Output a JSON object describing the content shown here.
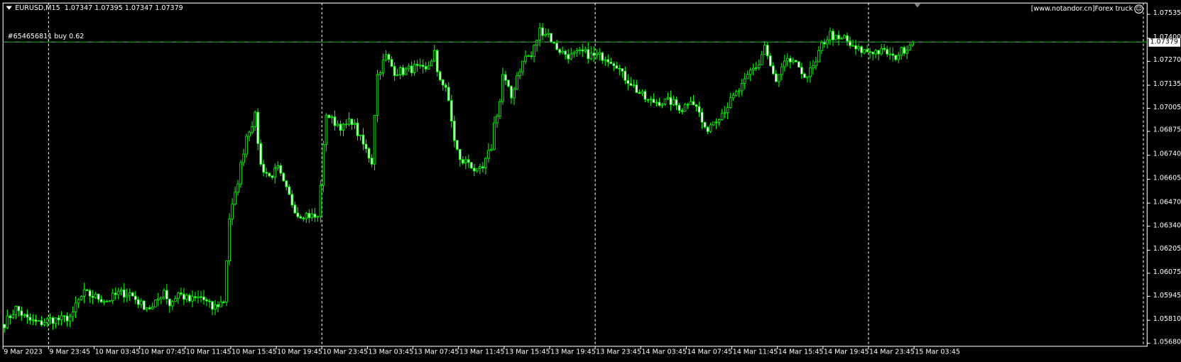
{
  "header": {
    "symbol": "EURUSD,M15",
    "ohlc": "1.07347 1.07395 1.07347 1.07379"
  },
  "order_line": {
    "label": "#654656811 buy 0.62",
    "price": 1.07379
  },
  "current_price_label": "1.07379",
  "brand": {
    "text": "[www.notandor.cn]Forex truck",
    "icon": "smiley-icon"
  },
  "colors": {
    "background": "#000000",
    "candle": "#00ff00",
    "bear_body": "#ffffff",
    "bull_body": "#000000",
    "grid": "#ffffff",
    "order_line": "#00c000"
  },
  "chart_data": {
    "type": "candlestick",
    "title": "EURUSD,M15",
    "ylim": [
      1.0568,
      1.07535
    ],
    "y_ticks": [
      "1.07535",
      "1.07400",
      "1.07270",
      "1.07135",
      "1.07005",
      "1.06875",
      "1.06740",
      "1.06605",
      "1.06470",
      "1.06340",
      "1.06205",
      "1.06075",
      "1.05945",
      "1.05810",
      "1.05680"
    ],
    "x_ticks": [
      "9 Mar 2023",
      "9 Mar 23:45",
      "10 Mar 03:45",
      "10 Mar 07:45",
      "10 Mar 11:45",
      "10 Mar 15:45",
      "10 Mar 19:45",
      "10 Mar 23:45",
      "13 Mar 03:45",
      "13 Mar 07:45",
      "13 Mar 11:45",
      "13 Mar 15:45",
      "13 Mar 19:45",
      "13 Mar 23:45",
      "14 Mar 03:45",
      "14 Mar 07:45",
      "14 Mar 11:45",
      "14 Mar 15:45",
      "14 Mar 19:45",
      "14 Mar 23:45",
      "15 Mar 03:45"
    ],
    "bars_per_x_tick": 16,
    "day_separator_bars": [
      16,
      112,
      208,
      304
    ],
    "close_anchors": [
      [
        0,
        1.05792
      ],
      [
        4,
        1.05877
      ],
      [
        8,
        1.05814
      ],
      [
        12,
        1.05792
      ],
      [
        16,
        1.05814
      ],
      [
        20,
        1.05814
      ],
      [
        24,
        1.05835
      ],
      [
        25,
        1.05898
      ],
      [
        28,
        1.05962
      ],
      [
        32,
        1.05941
      ],
      [
        36,
        1.0592
      ],
      [
        40,
        1.05962
      ],
      [
        44,
        1.05962
      ],
      [
        48,
        1.05898
      ],
      [
        52,
        1.05877
      ],
      [
        56,
        1.05983
      ],
      [
        58,
        1.05898
      ],
      [
        61,
        1.05962
      ],
      [
        65,
        1.0592
      ],
      [
        69,
        1.05941
      ],
      [
        73,
        1.05877
      ],
      [
        77,
        1.0592
      ],
      [
        79,
        1.06386
      ],
      [
        81,
        1.06513
      ],
      [
        83,
        1.06683
      ],
      [
        85,
        1.06852
      ],
      [
        88,
        1.06958
      ],
      [
        90,
        1.06683
      ],
      [
        93,
        1.06619
      ],
      [
        96,
        1.06662
      ],
      [
        98,
        1.06577
      ],
      [
        101,
        1.06471
      ],
      [
        103,
        1.06407
      ],
      [
        106,
        1.06407
      ],
      [
        110,
        1.06386
      ],
      [
        113,
        1.0698
      ],
      [
        115,
        1.06937
      ],
      [
        119,
        1.06895
      ],
      [
        122,
        1.06937
      ],
      [
        125,
        1.06831
      ],
      [
        127,
        1.06768
      ],
      [
        129,
        1.06704
      ],
      [
        130,
        1.0698
      ],
      [
        131,
        1.07192
      ],
      [
        134,
        1.07298
      ],
      [
        137,
        1.07213
      ],
      [
        140,
        1.07213
      ],
      [
        144,
        1.07234
      ],
      [
        148,
        1.07213
      ],
      [
        151,
        1.07319
      ],
      [
        152,
        1.07192
      ],
      [
        155,
        1.07128
      ],
      [
        158,
        1.06831
      ],
      [
        160,
        1.06704
      ],
      [
        163,
        1.06704
      ],
      [
        166,
        1.0664
      ],
      [
        168,
        1.06662
      ],
      [
        171,
        1.06789
      ],
      [
        172,
        1.06916
      ],
      [
        174,
        1.07043
      ],
      [
        175,
        1.07192
      ],
      [
        178,
        1.07064
      ],
      [
        180,
        1.07192
      ],
      [
        183,
        1.07298
      ],
      [
        185,
        1.07298
      ],
      [
        188,
        1.07446
      ],
      [
        191,
        1.07425
      ],
      [
        193,
        1.07361
      ],
      [
        196,
        1.07319
      ],
      [
        199,
        1.07298
      ],
      [
        203,
        1.07319
      ],
      [
        207,
        1.07298
      ],
      [
        211,
        1.07298
      ],
      [
        215,
        1.07255
      ],
      [
        217,
        1.07192
      ],
      [
        220,
        1.07149
      ],
      [
        222,
        1.07107
      ],
      [
        226,
        1.07043
      ],
      [
        230,
        1.07043
      ],
      [
        234,
        1.07043
      ],
      [
        238,
        1.07001
      ],
      [
        241,
        1.07064
      ],
      [
        244,
        1.0698
      ],
      [
        246,
        1.06874
      ],
      [
        249,
        1.06937
      ],
      [
        252,
        1.0698
      ],
      [
        254,
        1.07022
      ],
      [
        257,
        1.07086
      ],
      [
        260,
        1.07149
      ],
      [
        262,
        1.07213
      ],
      [
        265,
        1.07255
      ],
      [
        267,
        1.07361
      ],
      [
        269,
        1.07234
      ],
      [
        271,
        1.07149
      ],
      [
        274,
        1.07255
      ],
      [
        277,
        1.07276
      ],
      [
        279,
        1.07213
      ],
      [
        282,
        1.07192
      ],
      [
        285,
        1.07255
      ],
      [
        287,
        1.07361
      ],
      [
        290,
        1.07425
      ],
      [
        293,
        1.07382
      ],
      [
        295,
        1.07404
      ],
      [
        298,
        1.0734
      ],
      [
        302,
        1.07327
      ],
      [
        306,
        1.07327
      ],
      [
        310,
        1.07319
      ],
      [
        312,
        1.07285
      ],
      [
        315,
        1.07327
      ],
      [
        319,
        1.07379
      ]
    ]
  }
}
